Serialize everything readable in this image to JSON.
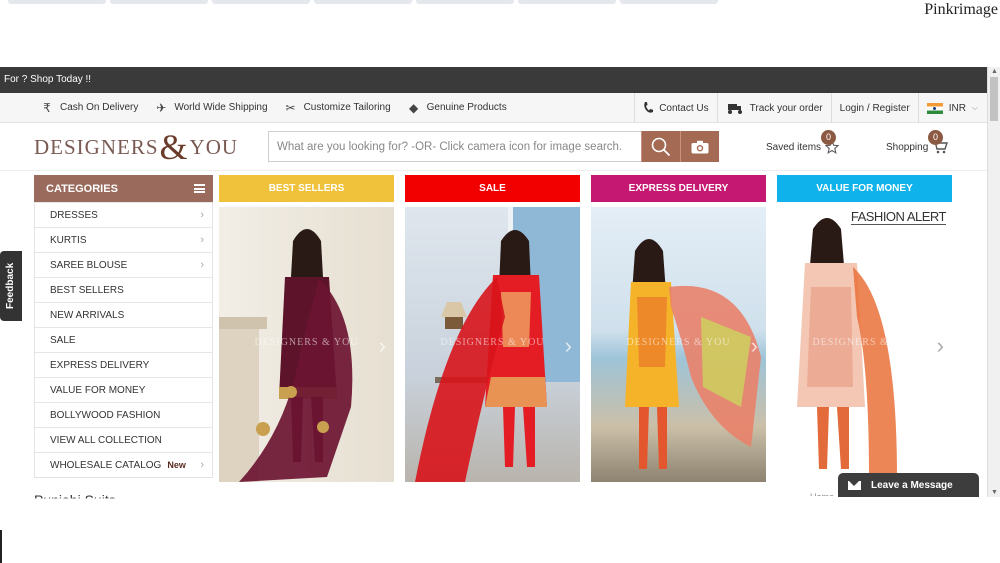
{
  "watermark": "Pinkrimage",
  "promo_text": "For ? Shop Today !!",
  "utility": {
    "left": [
      {
        "icon": "rupee-icon",
        "glyph": "₹",
        "label": "Cash On Delivery"
      },
      {
        "icon": "airplane-icon",
        "glyph": "✈",
        "label": "World Wide Shipping"
      },
      {
        "icon": "scissors-icon",
        "glyph": "✂",
        "label": "Customize Tailoring"
      },
      {
        "icon": "tag-icon",
        "glyph": "◆",
        "label": "Genuine Products"
      }
    ],
    "contact": "Contact Us",
    "track": "Track your order",
    "login": "Login / Register",
    "currency": "INR"
  },
  "header": {
    "logo_left": "DESIGNERS",
    "logo_amp": "&",
    "logo_right": "YOU",
    "search_placeholder": "What are you looking for? -OR- Click camera icon for image search.",
    "saved_label": "Saved items",
    "saved_count": "0",
    "shopping_label": "Shopping",
    "cart_count": "0"
  },
  "categories": {
    "title": "CATEGORIES",
    "items": [
      {
        "label": "DRESSES",
        "chevron": "›",
        "badge": ""
      },
      {
        "label": "KURTIS",
        "chevron": "›",
        "badge": ""
      },
      {
        "label": "SAREE BLOUSE",
        "chevron": "›",
        "badge": ""
      },
      {
        "label": "BEST SELLERS",
        "chevron": "",
        "badge": ""
      },
      {
        "label": "NEW ARRIVALS",
        "chevron": "",
        "badge": ""
      },
      {
        "label": "SALE",
        "chevron": "",
        "badge": ""
      },
      {
        "label": "EXPRESS DELIVERY",
        "chevron": "",
        "badge": ""
      },
      {
        "label": "VALUE FOR MONEY",
        "chevron": "",
        "badge": ""
      },
      {
        "label": "BOLLYWOOD FASHION",
        "chevron": "",
        "badge": ""
      },
      {
        "label": "VIEW ALL COLLECTION",
        "chevron": "",
        "badge": ""
      },
      {
        "label": "WHOLESALE CATALOG",
        "chevron": "›",
        "badge": "New"
      }
    ]
  },
  "promos": [
    {
      "label": "BEST SELLERS",
      "color": "#f0c23b"
    },
    {
      "label": "SALE",
      "color": "#f20000"
    },
    {
      "label": "EXPRESS DELIVERY",
      "color": "#c41872"
    },
    {
      "label": "VALUE FOR MONEY",
      "color": "#0fb2ea"
    }
  ],
  "image_watermark": "DESIGNERS & YOU",
  "fashion_alert": "FASHION ALERT",
  "feedback": "Feedback",
  "below_fold_heading": "Punjabi Suits",
  "below_fold_breadcrumb": "Home",
  "chat": "Leave a Message"
}
